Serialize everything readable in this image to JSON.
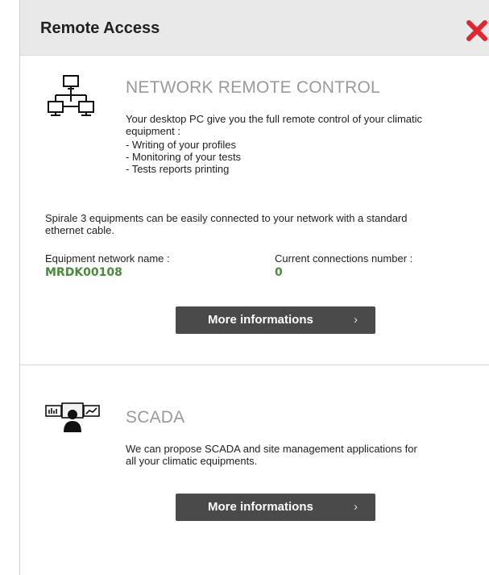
{
  "dialog": {
    "title": "Remote Access",
    "close_icon": "close-x-icon",
    "close_color": "#e0262f"
  },
  "network_section": {
    "icon": "network-computers-icon",
    "title": "NETWORK REMOTE CONTROL",
    "description_line1": "Your desktop PC give you the full remote control of your climatic",
    "description_line2": "equipment :",
    "features": [
      "- Writing of your profiles",
      "- Monitoring of your tests",
      "- Tests reports printing"
    ],
    "connection_info_line1": "Spirale 3 equipments can be easily connected to your network with a standard",
    "connection_info_line2": "ethernet cable.",
    "equipment_name_label": "Equipment network name :",
    "equipment_name_value": "MRDK00108",
    "connections_label": "Current connections number :",
    "connections_value": "0",
    "more_button_label": "More informations",
    "more_button_arrow": "›"
  },
  "scada_section": {
    "icon": "scada-monitoring-icon",
    "title": "SCADA",
    "description_line1": "We can propose SCADA and site management applications for",
    "description_line2": "all your climatic equipments.",
    "more_button_label": "More informations",
    "more_button_arrow": "›"
  },
  "colors": {
    "header_bg": "#e9e9e9",
    "button_bg": "#4a4a4a",
    "value_green": "#4a8a3c",
    "section_title_gray": "#9a9a9a"
  }
}
